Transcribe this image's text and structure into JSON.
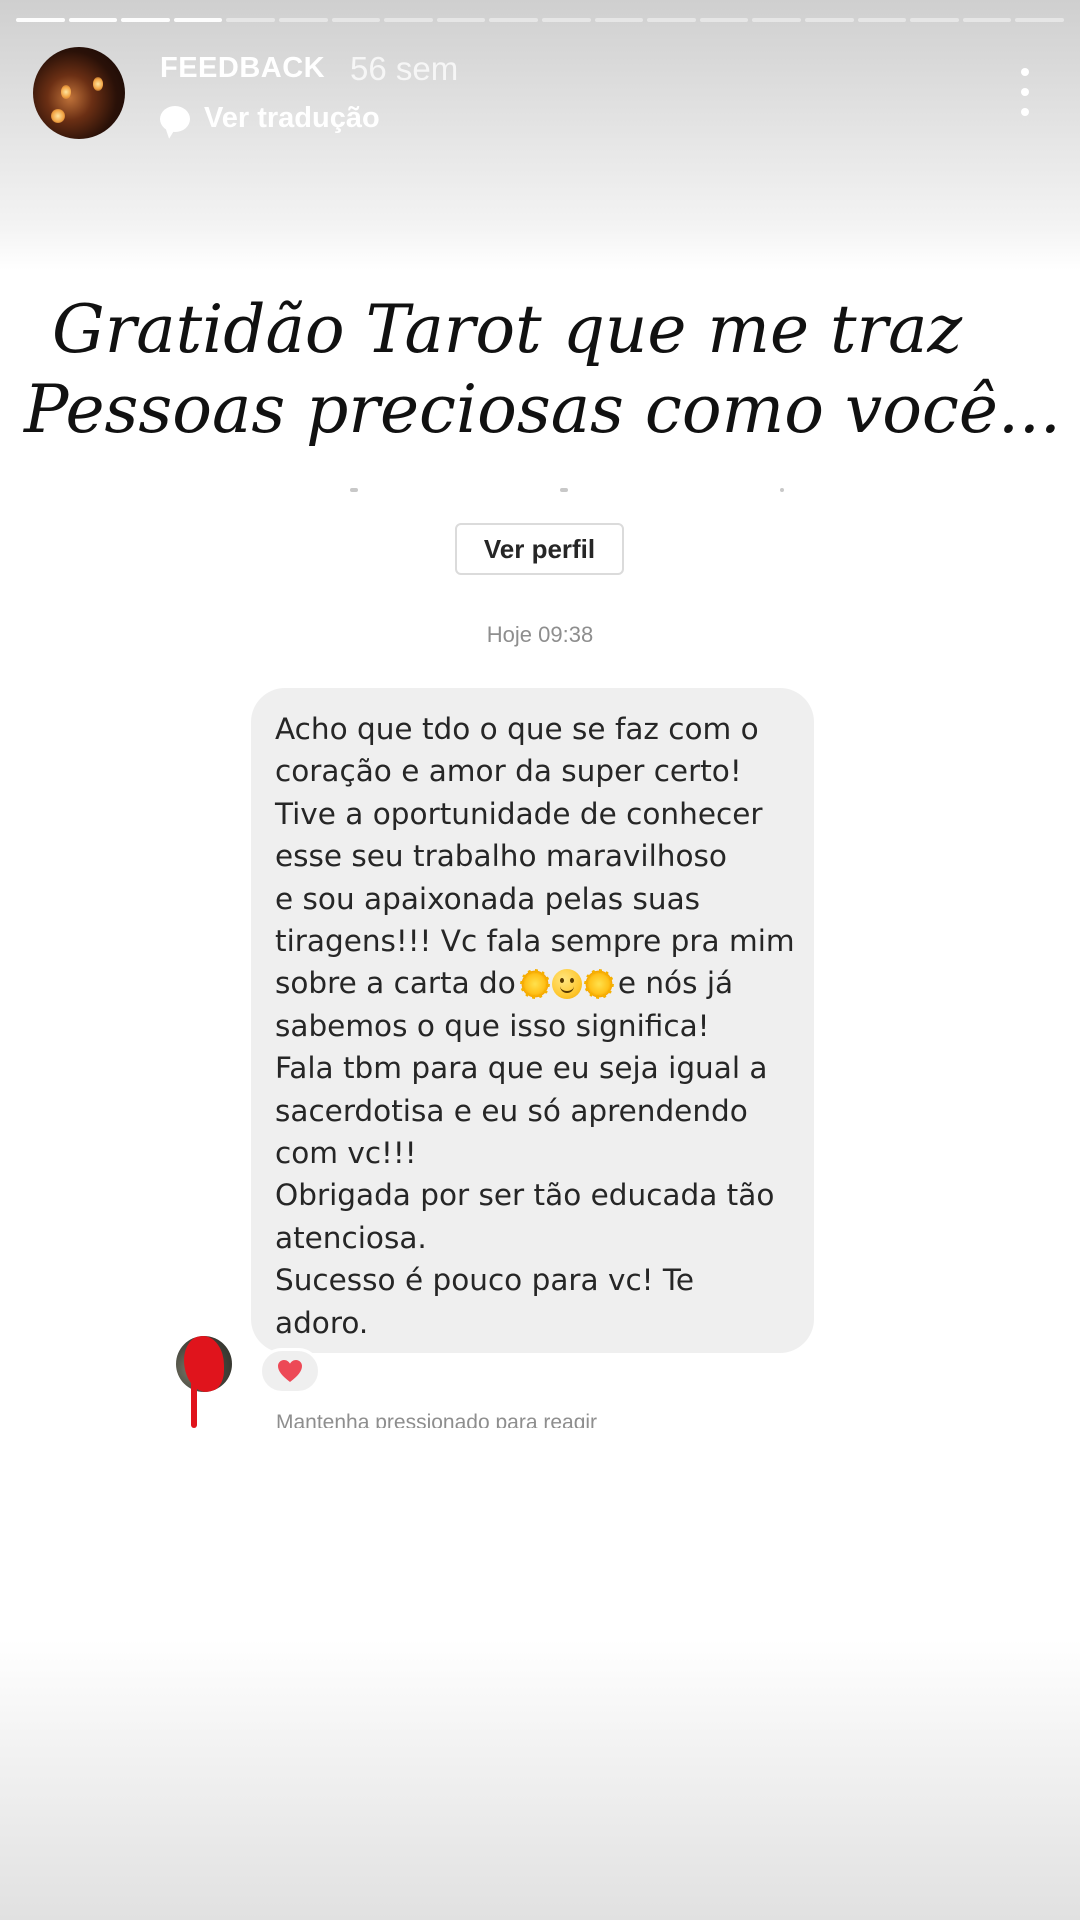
{
  "story": {
    "progress": {
      "segments_total": 20,
      "segments_viewed": 4
    },
    "username": "FEEDBACK",
    "timestamp": "56 sem",
    "translate_label": "Ver tradução",
    "more_icon": "more-vertical-icon"
  },
  "caption": {
    "line1": "Gratidão Tarot que me traz",
    "line2": "Pessoas preciosas como você..."
  },
  "conversation": {
    "view_profile_label": "Ver perfil",
    "message_time": "Hoje 09:38",
    "message": {
      "lines": [
        "Acho que tdo o que se faz com o",
        "coração e amor da super certo!",
        "Tive a oportunidade de conhecer",
        "esse seu trabalho maravilhoso",
        "e sou apaixonada pelas suas",
        "tiragens!!! Vc fala sempre pra mim",
        "sobre a carta do",
        "e nós já",
        "sabemos o que isso significa!",
        "Fala tbm para que eu seja igual a",
        "sacerdotisa e eu só aprendendo",
        "com vc!!!",
        "Obrigada por ser tão educada tão",
        "atenciosa.",
        "Sucesso é  pouco para vc! Te",
        "adoro."
      ],
      "emojis": [
        "sun-emoji",
        "smiling-face-emoji",
        "sun-with-face-emoji"
      ]
    },
    "reaction": {
      "icon": "red-heart-icon",
      "color": "#ed4956"
    },
    "hint": "Mantenha pressionado para reagir"
  },
  "colors": {
    "bubble": "#efefef",
    "text": "#262626",
    "muted": "#8e8e8e",
    "redaction": "#e0141c"
  }
}
